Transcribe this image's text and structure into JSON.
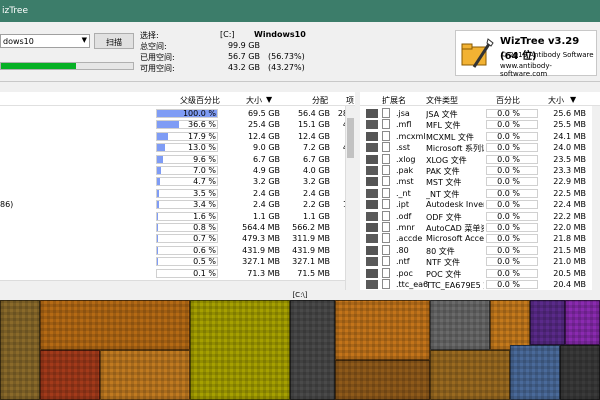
{
  "window": {
    "title": "izTree"
  },
  "toolbar": {
    "drive_value": "dows10",
    "scan_label": "扫描"
  },
  "usage": {
    "used_fraction": 0.5673
  },
  "info": {
    "select_label": "选择:",
    "drive_letter": "[C:]",
    "volume_name": "Windows10",
    "total_label": "总空间:",
    "total_value": "99.9 GB",
    "used_label": "已用空间:",
    "used_value": "56.7 GB",
    "used_pct": "(56.73%)",
    "free_label": "可用空间:",
    "free_value": "43.2 GB",
    "free_pct": "(43.27%)"
  },
  "brand": {
    "title": "WizTree v3.29 (64 位)",
    "copyright": "© 2019 Antibody Software",
    "url": "www.antibody-software.com"
  },
  "left_table": {
    "headers": {
      "parent_pct": "父级百分比",
      "size": "大小",
      "alloc": "分配",
      "items": "项"
    },
    "rows": [
      {
        "name": "",
        "pct": "100.0 %",
        "fill": 1.0,
        "size": "69.5 GB",
        "alloc": "56.4 GB",
        "items": "28",
        "sel": true
      },
      {
        "name": "",
        "pct": "36.6 %",
        "fill": 0.366,
        "size": "25.4 GB",
        "alloc": "15.1 GB",
        "items": "4"
      },
      {
        "name": "",
        "pct": "17.9 %",
        "fill": 0.179,
        "size": "12.4 GB",
        "alloc": "12.4 GB",
        "items": ""
      },
      {
        "name": "",
        "pct": "13.0 %",
        "fill": 0.13,
        "size": "9.0 GB",
        "alloc": "7.2 GB",
        "items": "4"
      },
      {
        "name": "",
        "pct": "9.6 %",
        "fill": 0.096,
        "size": "6.7 GB",
        "alloc": "6.7 GB",
        "items": ""
      },
      {
        "name": "",
        "pct": "7.0 %",
        "fill": 0.07,
        "size": "4.9 GB",
        "alloc": "4.0 GB",
        "items": ""
      },
      {
        "name": "",
        "pct": "4.7 %",
        "fill": 0.047,
        "size": "3.2 GB",
        "alloc": "3.2 GB",
        "items": ""
      },
      {
        "name": "",
        "pct": "3.5 %",
        "fill": 0.035,
        "size": "2.4 GB",
        "alloc": "2.4 GB",
        "items": ""
      },
      {
        "name": "86)",
        "pct": "3.4 %",
        "fill": 0.034,
        "size": "2.4 GB",
        "alloc": "2.2 GB",
        "items": "1"
      },
      {
        "name": "",
        "pct": "1.6 %",
        "fill": 0.016,
        "size": "1.1 GB",
        "alloc": "1.1 GB",
        "items": ""
      },
      {
        "name": "",
        "pct": "0.8 %",
        "fill": 0.008,
        "size": "564.4 MB",
        "alloc": "566.2 MB",
        "items": ""
      },
      {
        "name": "",
        "pct": "0.7 %",
        "fill": 0.007,
        "size": "479.3 MB",
        "alloc": "311.9 MB",
        "items": ""
      },
      {
        "name": "",
        "pct": "0.6 %",
        "fill": 0.006,
        "size": "431.9 MB",
        "alloc": "431.9 MB",
        "items": ""
      },
      {
        "name": "",
        "pct": "0.5 %",
        "fill": 0.005,
        "size": "327.1 MB",
        "alloc": "327.1 MB",
        "items": ""
      },
      {
        "name": "",
        "pct": "0.1 %",
        "fill": 0.001,
        "size": "71.3 MB",
        "alloc": "71.5 MB",
        "items": ""
      }
    ]
  },
  "right_table": {
    "headers": {
      "ext": "扩展名",
      "type": "文件类型",
      "pct": "百分比",
      "size": "大小"
    },
    "rows": [
      {
        "ext": ".jsa",
        "type": "JSA 文件",
        "pct": "0.0 %",
        "size": "25.6 MB",
        "color": "#555555"
      },
      {
        "ext": ".mfl",
        "type": "MFL 文件",
        "pct": "0.0 %",
        "size": "25.5 MB",
        "color": "#5a5a5a"
      },
      {
        "ext": ".mcxml",
        "type": "MCXML 文件",
        "pct": "0.0 %",
        "size": "24.1 MB",
        "color": "#555555"
      },
      {
        "ext": ".sst",
        "type": "Microsoft 系列证书",
        "pct": "0.0 %",
        "size": "24.0 MB",
        "color": "#5a5a5a"
      },
      {
        "ext": ".xlog",
        "type": "XLOG 文件",
        "pct": "0.0 %",
        "size": "23.5 MB",
        "color": "#555555"
      },
      {
        "ext": ".pak",
        "type": "PAK 文件",
        "pct": "0.0 %",
        "size": "23.3 MB",
        "color": "#5a5a5a"
      },
      {
        "ext": ".mst",
        "type": "MST 文件",
        "pct": "0.0 %",
        "size": "22.9 MB",
        "color": "#555555"
      },
      {
        "ext": "._nt",
        "type": "_NT 文件",
        "pct": "0.0 %",
        "size": "22.5 MB",
        "color": "#5a5a5a"
      },
      {
        "ext": ".ipt",
        "type": "Autodesk Inventor",
        "pct": "0.0 %",
        "size": "22.4 MB",
        "color": "#555555"
      },
      {
        "ext": ".odf",
        "type": "ODF 文件",
        "pct": "0.0 %",
        "size": "22.2 MB",
        "color": "#5a5a5a"
      },
      {
        "ext": ".mnr",
        "type": "AutoCAD 菜单资源",
        "pct": "0.0 %",
        "size": "22.0 MB",
        "color": "#555555"
      },
      {
        "ext": ".accde",
        "type": "Microsoft Access A",
        "pct": "0.0 %",
        "size": "21.8 MB",
        "color": "#5a5a5a"
      },
      {
        "ext": ".80",
        "type": "80 文件",
        "pct": "0.0 %",
        "size": "21.5 MB",
        "color": "#555555"
      },
      {
        "ext": ".ntf",
        "type": "NTF 文件",
        "pct": "0.0 %",
        "size": "21.0 MB",
        "color": "#5a5a5a"
      },
      {
        "ext": ".poc",
        "type": "POC 文件",
        "pct": "0.0 %",
        "size": "20.5 MB",
        "color": "#555555"
      },
      {
        "ext": ".ttc_ea6",
        "type": "TTC_EA679E5 文件",
        "pct": "0.0 %",
        "size": "20.4 MB",
        "color": "#5a5a5a"
      }
    ]
  },
  "treemap": {
    "path": "[C:\\]"
  }
}
